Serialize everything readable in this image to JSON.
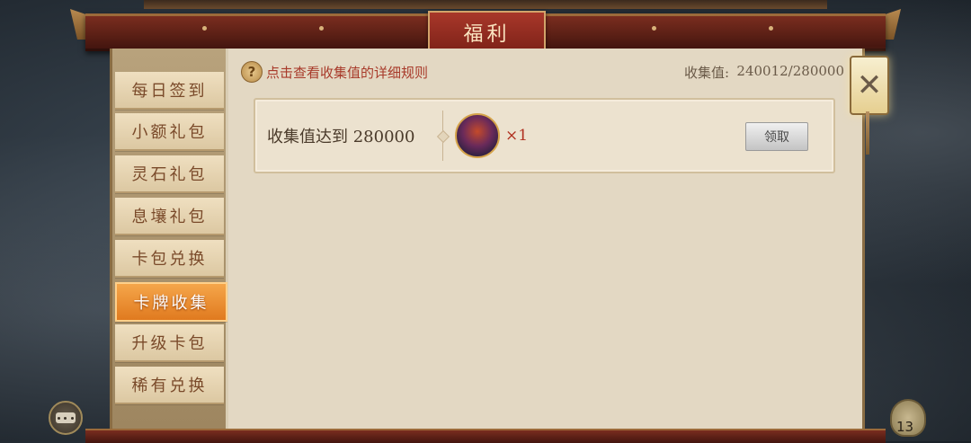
{
  "window": {
    "title": "福利"
  },
  "sidebar": {
    "items": [
      {
        "label": "每日签到",
        "active": false
      },
      {
        "label": "小额礼包",
        "active": false
      },
      {
        "label": "灵石礼包",
        "active": false
      },
      {
        "label": "息壤礼包",
        "active": false
      },
      {
        "label": "卡包兑换",
        "active": false
      },
      {
        "label": "卡牌收集",
        "active": true
      },
      {
        "label": "升级卡包",
        "active": false
      },
      {
        "label": "稀有兑换",
        "active": false
      }
    ]
  },
  "info": {
    "help_icon": "question-icon",
    "help_glyph": "?",
    "rules_link": "点击查看收集值的详细规则",
    "collect_label": "收集值:",
    "collect_value": "240012/280000"
  },
  "rewards": [
    {
      "requirement": "收集值达到 280000",
      "item_icon": "card-avatar-icon",
      "quantity": "×1",
      "button": "领取"
    }
  ],
  "controls": {
    "close_glyph": "✕",
    "chat_icon": "chat-icon",
    "badge_count": "13"
  },
  "colors": {
    "accent_red": "#a83a2a",
    "active_tab": "#e07a1f",
    "panel_bg": "#e3d8c3"
  }
}
